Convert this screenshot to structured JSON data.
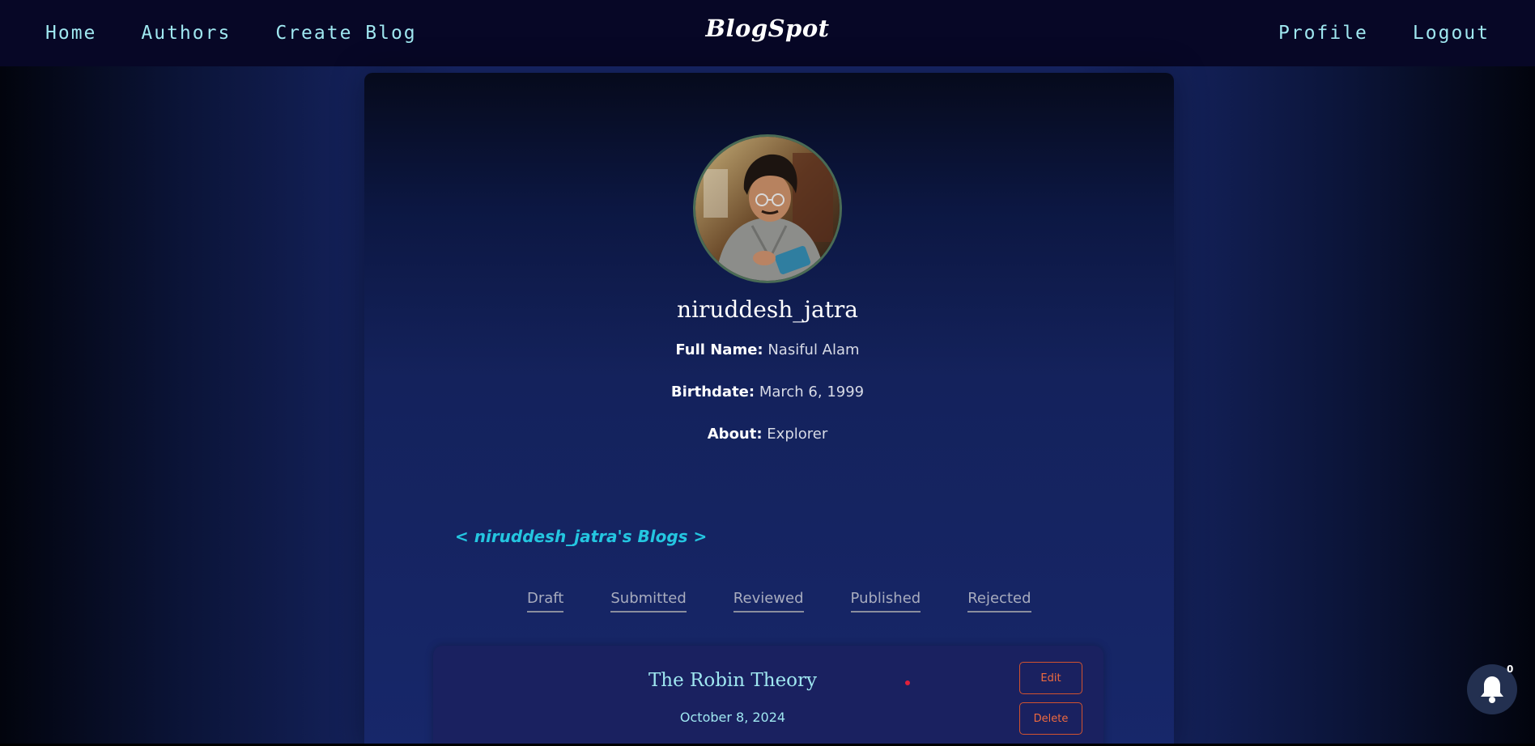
{
  "nav": {
    "left": [
      "Home",
      "Authors",
      "Create Blog"
    ],
    "brand": "BlogSpot",
    "right": [
      "Profile",
      "Logout"
    ]
  },
  "profile": {
    "avatar_icon": "user-photo",
    "username": "niruddesh_jatra",
    "full_name_label": "Full Name:",
    "full_name": "Nasiful Alam",
    "birthdate_label": "Birthdate:",
    "birthdate": "March 6, 1999",
    "about_label": "About:",
    "about": "Explorer"
  },
  "blogs": {
    "heading": "< niruddesh_jatra's Blogs >",
    "tabs": [
      "Draft",
      "Submitted",
      "Reviewed",
      "Published",
      "Rejected"
    ],
    "items": [
      {
        "title": "The Robin Theory",
        "date": "October 8, 2024",
        "edit_label": "Edit",
        "delete_label": "Delete"
      }
    ]
  },
  "notifications": {
    "icon": "bell-icon",
    "count": "0"
  },
  "colors": {
    "accent": "#9fe7f0",
    "heading": "#24c6e0",
    "danger": "#ef6a3f"
  }
}
